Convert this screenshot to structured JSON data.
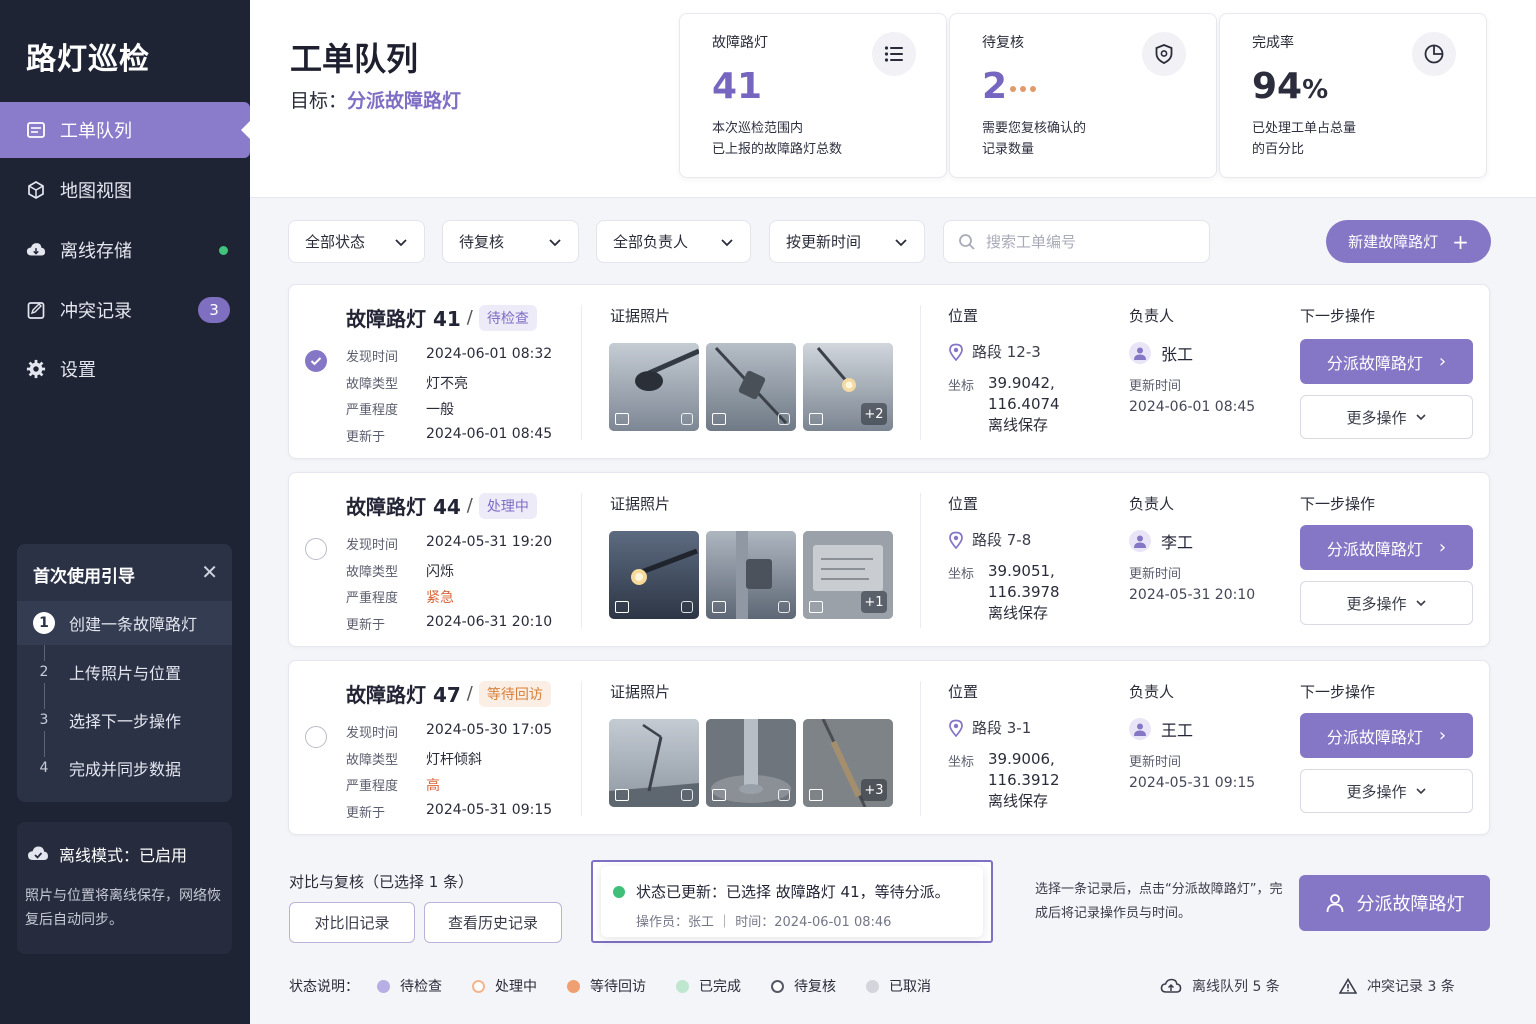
{
  "sidebar": {
    "brand": "路灯巡检",
    "items": [
      {
        "label": "工单队列",
        "icon": "inbox-icon"
      },
      {
        "label": "地图视图",
        "icon": "cube-icon"
      },
      {
        "label": "离线存储",
        "icon": "cloud-icon"
      },
      {
        "label": "冲突记录",
        "icon": "edit-doc-icon",
        "badge": "3"
      },
      {
        "label": "设置",
        "icon": "gear-icon"
      }
    ],
    "guide": {
      "title": "首次使用引导",
      "steps": [
        {
          "num": "1",
          "label": "创建一条故障路灯"
        },
        {
          "num": "2",
          "label": "上传照片与位置"
        },
        {
          "num": "3",
          "label": "选择下一步操作"
        },
        {
          "num": "4",
          "label": "完成并同步数据"
        }
      ]
    },
    "offline": {
      "title": "离线模式：已启用",
      "desc": "照片与位置将离线保存，网络恢复后自动同步。"
    }
  },
  "header": {
    "title": "工单队列",
    "goal_label": "目标：",
    "goal_value": "分派故障路灯",
    "stats": [
      {
        "label": "故障路灯",
        "value": "41",
        "desc1": "本次巡检范围内",
        "desc2": "已上报的故障路灯总数",
        "icon": "list-icon"
      },
      {
        "label": "待复核",
        "value": "2",
        "desc1": "需要您复核确认的",
        "desc2": "记录数量",
        "icon": "shield-icon"
      },
      {
        "label": "完成率",
        "value": "94",
        "unit": "%",
        "desc1": "已处理工单占总量",
        "desc2": "的百分比",
        "icon": "pie-chart-icon"
      }
    ]
  },
  "filters": {
    "status": "全部状态",
    "review": "待复核",
    "owner": "全部负责人",
    "sort": "按更新时间",
    "search_placeholder": "搜索工单编号",
    "new_button": "新建故障路灯"
  },
  "labels": {
    "found": "发现时间",
    "type": "故障类型",
    "severity": "严重程度",
    "updated": "更新于",
    "photos": "证据照片",
    "location": "位置",
    "coord": "坐标",
    "owner": "负责人",
    "update_time": "更新时间",
    "next": "下一步操作",
    "assign": "分派故障路灯",
    "more": "更多操作"
  },
  "cards": [
    {
      "title": "故障路灯 41",
      "status": "待检查",
      "found": "2024-06-01 08:32",
      "type": "灯不亮",
      "severity": "一般",
      "updated": "2024-06-01 08:45",
      "photo_more": "+2",
      "segment": "路段 12-3",
      "lat": "39.9042,",
      "lng": "116.4074",
      "storage": "离线保存",
      "owner": "张工",
      "owner_time": "2024-06-01 08:45"
    },
    {
      "title": "故障路灯 44",
      "status": "处理中",
      "found": "2024-05-31 19:20",
      "type": "闪烁",
      "severity": "紧急",
      "updated": "2024-06-31 20:10",
      "photo_more": "+1",
      "segment": "路段 7-8",
      "lat": "39.9051,",
      "lng": "116.3978",
      "storage": "离线保存",
      "owner": "李工",
      "owner_time": "2024-05-31 20:10"
    },
    {
      "title": "故障路灯 47",
      "status": "等待回访",
      "found": "2024-05-30 17:05",
      "type": "灯杆倾斜",
      "severity": "高",
      "updated": "2024-05-31 09:15",
      "photo_more": "+3",
      "segment": "路段 3-1",
      "lat": "39.9006,",
      "lng": "116.3912",
      "storage": "离线保存",
      "owner": "王工",
      "owner_time": "2024-05-31 09:15"
    }
  ],
  "bottom": {
    "compare_title": "对比与复核（已选择 1 条）",
    "compare_btn": "对比旧记录",
    "history_btn": "查看历史记录",
    "toast_msg": "状态已更新：已选择 故障路灯 41，等待分派。",
    "toast_sub": "操作员：张工 ｜ 时间：2024-06-01 08:46",
    "hint": "选择一条记录后，点击“分派故障路灯”，完成后将记录操作员与时间。",
    "assign_btn": "分派故障路灯"
  },
  "legend": {
    "title": "状态说明：",
    "items": [
      {
        "label": "待检查",
        "color": "#b7aee3"
      },
      {
        "label": "处理中",
        "color": "#f6c6a6"
      },
      {
        "label": "等待回访",
        "color": "#f0a070"
      },
      {
        "label": "已完成",
        "color": "#bfe6cf"
      },
      {
        "label": "待复核",
        "color": "#ffffff"
      },
      {
        "label": "已取消",
        "color": "#d4d5dc"
      }
    ]
  },
  "footer": {
    "offline_queue": "离线队列  5 条",
    "conflicts": "冲突记录  3 条"
  },
  "colors": {
    "accent": "#8676c6",
    "sidebar_bg": "#1f2435",
    "online_dot": "#3fc47b"
  }
}
